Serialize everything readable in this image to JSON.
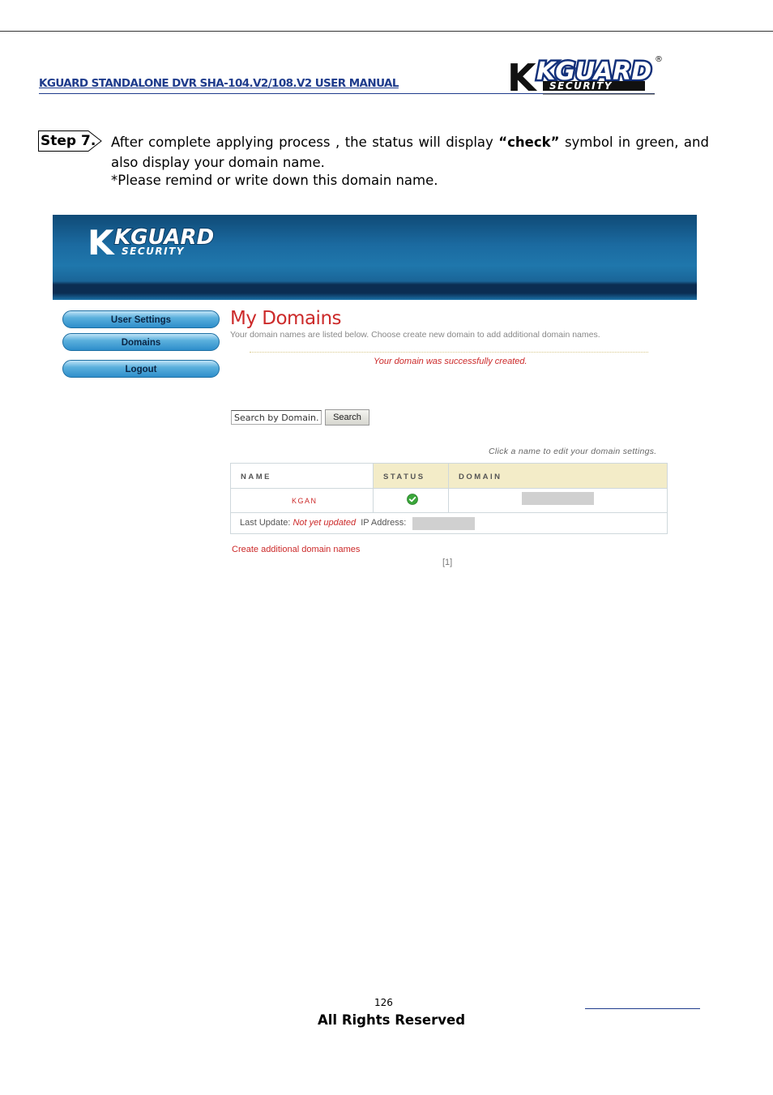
{
  "header": {
    "doc_title": "KGUARD STANDALONE DVR SHA-104.V2/108.V2 USER MANUAL",
    "logo_main": "KGUARD",
    "logo_sub": "SECURITY",
    "registered_mark": "®"
  },
  "step": {
    "label": "Step 7.",
    "text_before": "After complete applying process , the status will display ",
    "text_bold": "“check”",
    "text_after": " symbol in green, and also display your domain name.",
    "remind": "*Please remind or write down this domain name."
  },
  "screenshot": {
    "banner_logo_main": "KGUARD",
    "banner_logo_sub": "SECURITY",
    "nav": {
      "user_settings": "User Settings",
      "domains": "Domains",
      "logout": "Logout"
    },
    "title": "My Domains",
    "subtitle": "Your domain names are listed below. Choose create new domain to add additional domain names.",
    "success_message": "Your domain was successfully created.",
    "search": {
      "placeholder": "Search by Domain.",
      "button": "Search"
    },
    "click_hint": "Click a name to edit your domain settings.",
    "table": {
      "headers": [
        "NAME",
        "STATUS",
        "DOMAIN"
      ],
      "row_name": "KGAN",
      "last_update_label": "Last Update:",
      "last_update_value": "Not yet updated",
      "ip_label": "IP Address:"
    },
    "create_link": "Create additional domain names",
    "pager": "[1]"
  },
  "footer": {
    "page_number": "126",
    "rights": "All Rights Reserved"
  },
  "colors": {
    "title_blue": "#1f3c8c",
    "accent_red": "#cc2a2a",
    "banner_blue": "#1b6aa0",
    "header_cell": "#f3ecc8",
    "check_green": "#3aa63a"
  }
}
